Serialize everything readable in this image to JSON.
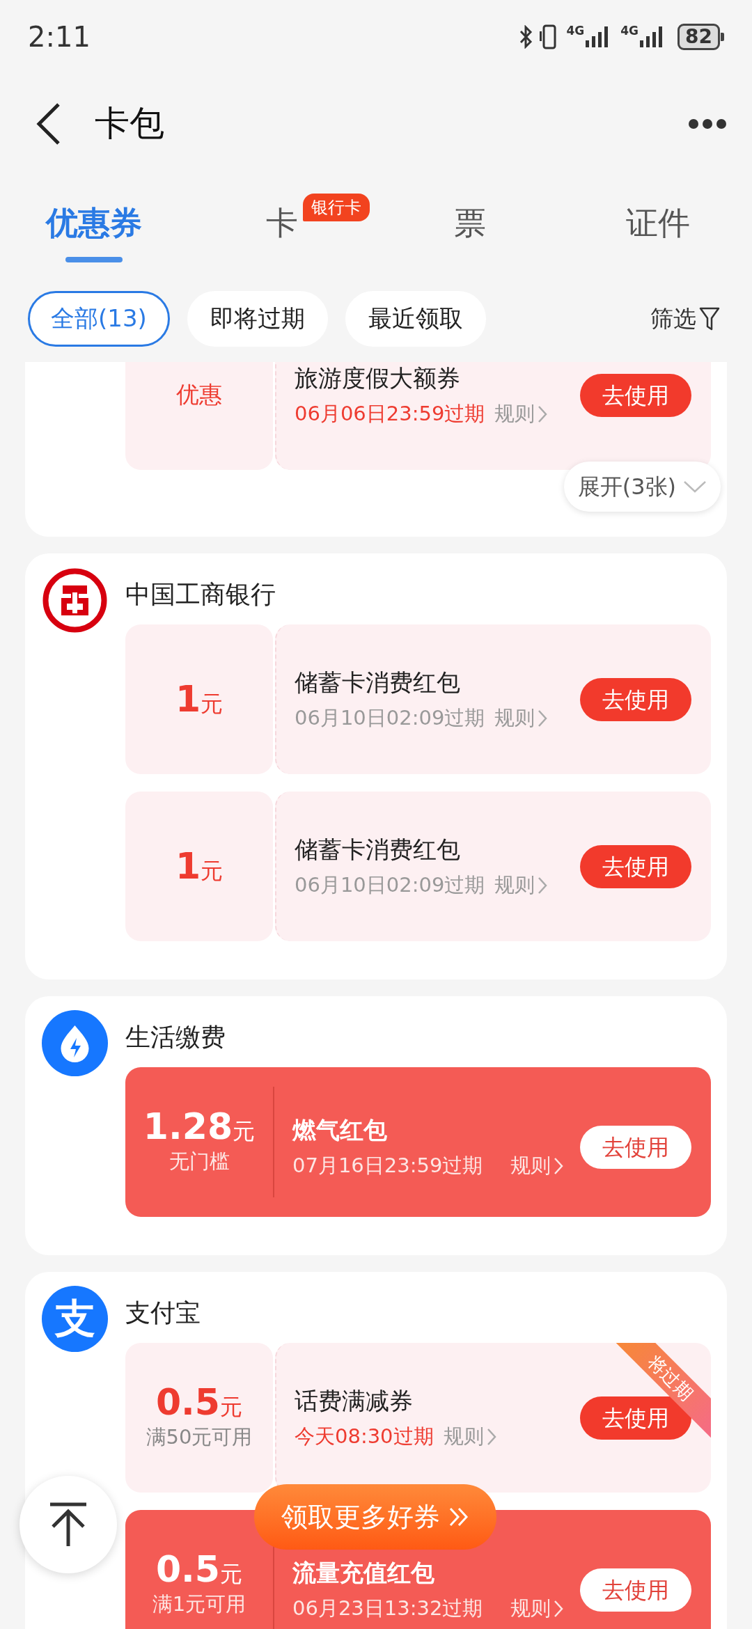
{
  "status_bar": {
    "time": "2:11",
    "network_labels": [
      "4G",
      "4G"
    ],
    "battery": "82"
  },
  "header": {
    "title": "卡包"
  },
  "tabs": [
    {
      "label": "优惠券",
      "selected": true
    },
    {
      "label": "卡",
      "selected": false,
      "badge": "银行卡"
    },
    {
      "label": "票",
      "selected": false
    },
    {
      "label": "证件",
      "selected": false
    }
  ],
  "filters": [
    {
      "label": "全部(13)",
      "selected": true
    },
    {
      "label": "即将过期",
      "selected": false
    },
    {
      "label": "最近领取",
      "selected": false
    }
  ],
  "filter_button": {
    "label": "筛选"
  },
  "groups": [
    {
      "coupons": [
        {
          "kind": "light",
          "amount": "优惠",
          "title": "旅游度假大额券",
          "expiry": "06月06日23:59过期",
          "urgent": true,
          "rules": "规则",
          "button": "去使用"
        }
      ],
      "expand": "展开(3张)"
    },
    {
      "name": "中国工商银行",
      "kind": "icbc",
      "coupons": [
        {
          "kind": "light",
          "amount": "1",
          "unit": "元",
          "title": "储蓄卡消费红包",
          "expiry": "06月10日02:09过期",
          "urgent": false,
          "rules": "规则",
          "button": "去使用"
        },
        {
          "kind": "light",
          "amount": "1",
          "unit": "元",
          "title": "储蓄卡消费红包",
          "expiry": "06月10日02:09过期",
          "urgent": false,
          "rules": "规则",
          "button": "去使用"
        }
      ]
    },
    {
      "name": "生活缴费",
      "kind": "utility",
      "coupons": [
        {
          "kind": "solid",
          "amount": "1.28",
          "unit": "元",
          "condition": "无门槛",
          "title": "燃气红包",
          "expiry": "07月16日23:59过期",
          "urgent": false,
          "rules": "规则",
          "button": "去使用"
        }
      ]
    },
    {
      "name": "支付宝",
      "kind": "alipay",
      "logo_text": "支",
      "coupons": [
        {
          "kind": "light",
          "amount": "0.5",
          "unit": "元",
          "condition": "满50元可用",
          "title": "话费满减券",
          "expiry": "今天08:30过期",
          "urgent": true,
          "rules": "规则",
          "button": "去使用",
          "ribbon": "将过期"
        },
        {
          "kind": "solid",
          "amount": "0.5",
          "unit": "元",
          "condition": "满1元可用",
          "title": "流量充值红包",
          "expiry": "06月23日13:32过期",
          "urgent": false,
          "rules": "规则",
          "button": "去使用"
        }
      ]
    }
  ],
  "more_coupons_button": "领取更多好券"
}
